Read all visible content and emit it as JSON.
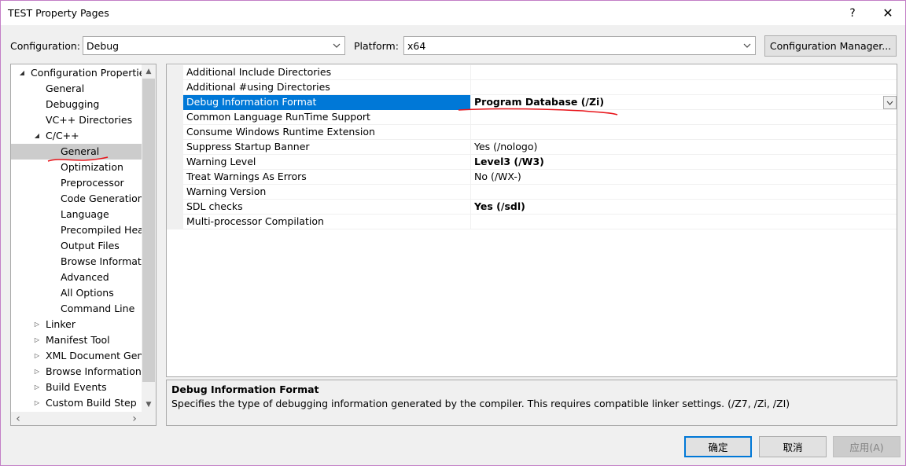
{
  "window": {
    "title": "TEST Property Pages",
    "help": "?",
    "close": "✕"
  },
  "configuration": {
    "label": "Configuration:",
    "value": "Debug"
  },
  "platform": {
    "label": "Platform:",
    "value": "x64"
  },
  "config_manager": "Configuration Manager...",
  "tree": [
    {
      "label": "Configuration Properties",
      "level": 0,
      "expander": "expanded"
    },
    {
      "label": "General",
      "level": 1,
      "expander": "none"
    },
    {
      "label": "Debugging",
      "level": 1,
      "expander": "none"
    },
    {
      "label": "VC++ Directories",
      "level": 1,
      "expander": "none"
    },
    {
      "label": "C/C++",
      "level": 1,
      "expander": "expanded"
    },
    {
      "label": "General",
      "level": 2,
      "expander": "none",
      "selected": true
    },
    {
      "label": "Optimization",
      "level": 2,
      "expander": "none"
    },
    {
      "label": "Preprocessor",
      "level": 2,
      "expander": "none"
    },
    {
      "label": "Code Generation",
      "level": 2,
      "expander": "none"
    },
    {
      "label": "Language",
      "level": 2,
      "expander": "none"
    },
    {
      "label": "Precompiled Heac",
      "level": 2,
      "expander": "none"
    },
    {
      "label": "Output Files",
      "level": 2,
      "expander": "none"
    },
    {
      "label": "Browse Informatic",
      "level": 2,
      "expander": "none"
    },
    {
      "label": "Advanced",
      "level": 2,
      "expander": "none"
    },
    {
      "label": "All Options",
      "level": 2,
      "expander": "none"
    },
    {
      "label": "Command Line",
      "level": 2,
      "expander": "none"
    },
    {
      "label": "Linker",
      "level": 1,
      "expander": "collapsed"
    },
    {
      "label": "Manifest Tool",
      "level": 1,
      "expander": "collapsed"
    },
    {
      "label": "XML Document Gene",
      "level": 1,
      "expander": "collapsed"
    },
    {
      "label": "Browse Information",
      "level": 1,
      "expander": "collapsed"
    },
    {
      "label": "Build Events",
      "level": 1,
      "expander": "collapsed"
    },
    {
      "label": "Custom Build Step",
      "level": 1,
      "expander": "collapsed"
    }
  ],
  "scroll_glyphs": {
    "up": "▲",
    "down": "▼",
    "left": "‹",
    "right": "›"
  },
  "properties": [
    {
      "name": "Additional Include Directories",
      "value": "",
      "bold": false
    },
    {
      "name": "Additional #using Directories",
      "value": "",
      "bold": false
    },
    {
      "name": "Debug Information Format",
      "value": "Program Database (/Zi)",
      "bold": true,
      "selected": true
    },
    {
      "name": "Common Language RunTime Support",
      "value": "",
      "bold": false
    },
    {
      "name": "Consume Windows Runtime Extension",
      "value": "",
      "bold": false
    },
    {
      "name": "Suppress Startup Banner",
      "value": "Yes (/nologo)",
      "bold": false
    },
    {
      "name": "Warning Level",
      "value": "Level3 (/W3)",
      "bold": true
    },
    {
      "name": "Treat Warnings As Errors",
      "value": "No (/WX-)",
      "bold": false
    },
    {
      "name": "Warning Version",
      "value": "",
      "bold": false
    },
    {
      "name": "SDL checks",
      "value": "Yes (/sdl)",
      "bold": true
    },
    {
      "name": "Multi-processor Compilation",
      "value": "",
      "bold": false
    }
  ],
  "description": {
    "title": "Debug Information Format",
    "text": "Specifies the type of debugging information generated by the compiler.  This requires compatible linker settings.     (/Z7, /Zi, /ZI)"
  },
  "buttons": {
    "ok": "确定",
    "cancel": "取消",
    "apply": "应用(A)"
  },
  "icons": {
    "dropdown": "chevron-down-icon",
    "expanded": "triangle-expanded-icon",
    "collapsed": "triangle-collapsed-icon"
  },
  "colors": {
    "selection": "#0078d7",
    "annotation": "#e8141a",
    "tree_selection": "#cccccc"
  }
}
